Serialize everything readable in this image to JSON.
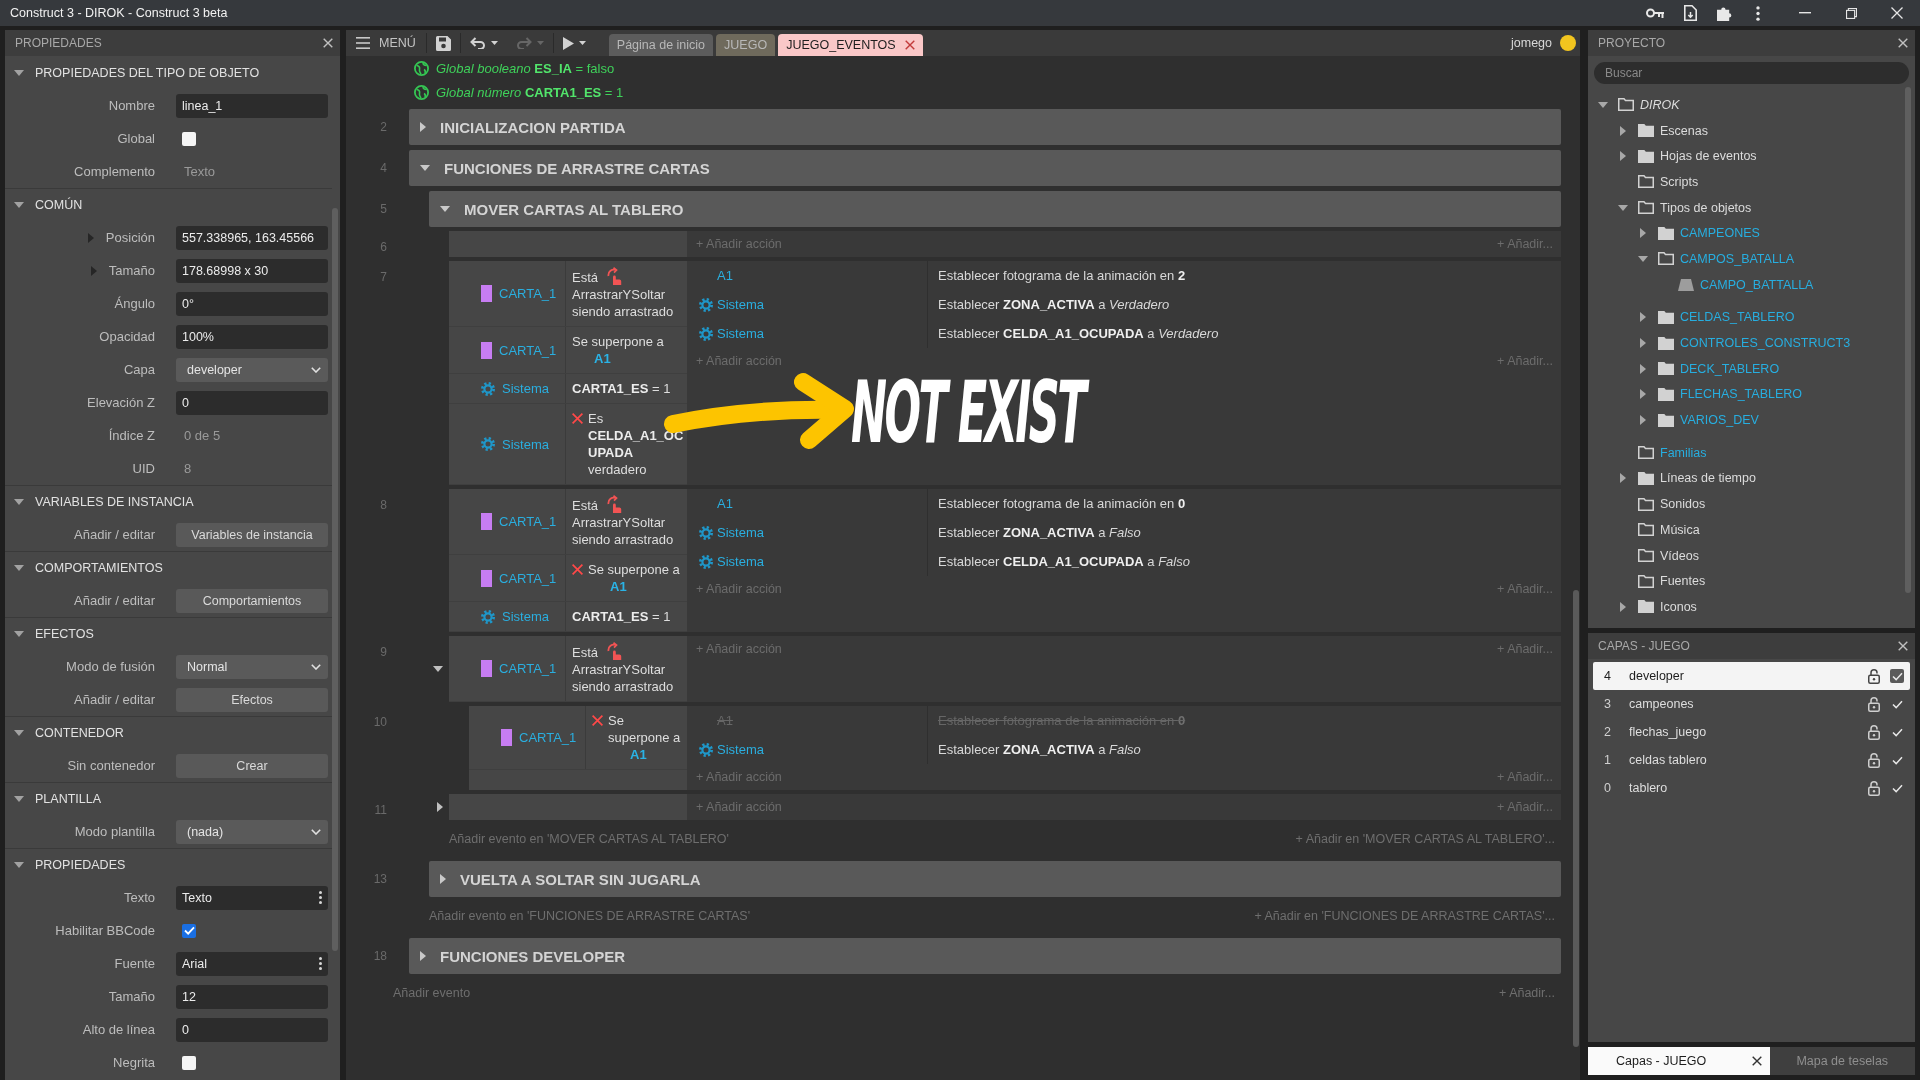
{
  "title_bar": {
    "title": "Construct 3 - DIROK - Construct 3 beta"
  },
  "properties_panel": {
    "title": "PROPIEDADES",
    "sections": [
      {
        "title": "PROPIEDADES DEL TIPO DE OBJETO",
        "expanded": true,
        "rows": [
          {
            "label": "Nombre",
            "kind": "input",
            "value": "linea_1"
          },
          {
            "label": "Global",
            "kind": "checkbox",
            "checked": false
          },
          {
            "label": "Complemento",
            "kind": "readonly",
            "value": "Texto"
          }
        ]
      },
      {
        "title": "COMÚN",
        "expanded": true,
        "rows": [
          {
            "label": "Posición",
            "kind": "input",
            "value": "557.338965, 163.45566",
            "expanded": false
          },
          {
            "label": "Tamaño",
            "kind": "input",
            "value": "178.68998 x 30",
            "expanded": false
          },
          {
            "label": "Ángulo",
            "kind": "input",
            "value": "0°"
          },
          {
            "label": "Opacidad",
            "kind": "input",
            "value": "100%"
          },
          {
            "label": "Capa",
            "kind": "select",
            "value": "developer"
          },
          {
            "label": "Elevación Z",
            "kind": "input",
            "value": "0"
          },
          {
            "label": "Índice Z",
            "kind": "readonly",
            "value": "0 de 5"
          },
          {
            "label": "UID",
            "kind": "readonly",
            "value": "8"
          }
        ]
      },
      {
        "title": "VARIABLES DE INSTANCIA",
        "expanded": true,
        "rows": [
          {
            "label": "Añadir / editar",
            "kind": "button",
            "value": "Variables de instancia"
          }
        ]
      },
      {
        "title": "COMPORTAMIENTOS",
        "expanded": true,
        "rows": [
          {
            "label": "Añadir / editar",
            "kind": "button",
            "value": "Comportamientos"
          }
        ]
      },
      {
        "title": "EFECTOS",
        "expanded": true,
        "rows": [
          {
            "label": "Modo de fusión",
            "kind": "select",
            "value": "Normal"
          },
          {
            "label": "Añadir / editar",
            "kind": "button",
            "value": "Efectos"
          }
        ]
      },
      {
        "title": "CONTENEDOR",
        "expanded": true,
        "rows": [
          {
            "label": "Sin contenedor",
            "kind": "button",
            "value": "Crear"
          }
        ]
      },
      {
        "title": "PLANTILLA",
        "expanded": true,
        "rows": [
          {
            "label": "Modo plantilla",
            "kind": "select",
            "value": "(nada)"
          }
        ]
      },
      {
        "title": "PROPIEDADES",
        "expanded": true,
        "rows": [
          {
            "label": "Texto",
            "kind": "input_menu",
            "value": "Texto"
          },
          {
            "label": "Habilitar BBCode",
            "kind": "checkbox",
            "checked": true
          },
          {
            "label": "Fuente",
            "kind": "input_menu",
            "value": "Arial"
          },
          {
            "label": "Tamaño",
            "kind": "input",
            "value": "12"
          },
          {
            "label": "Alto de línea",
            "kind": "input",
            "value": "0"
          },
          {
            "label": "Negrita",
            "kind": "checkbox",
            "checked": false
          }
        ]
      }
    ]
  },
  "editor": {
    "toolbar": {
      "menu_label": "MENÚ",
      "buttons": [
        {
          "kind": "save",
          "disabled": false
        },
        {
          "kind": "undo",
          "disabled": false
        },
        {
          "kind": "redo",
          "disabled": true
        },
        {
          "kind": "run",
          "disabled": false
        }
      ],
      "tabs": [
        {
          "label": "Página de inicio",
          "selected": false,
          "color": "#5c5c5c"
        },
        {
          "label": "JUEGO",
          "selected": false,
          "color": "#6f6a5c"
        },
        {
          "label": "JUEGO_EVENTOS",
          "selected": true,
          "color": "#fac8c8"
        }
      ],
      "user": "jomego"
    },
    "globals": [
      "*Global booleano* **ES_IA** = falso",
      "*Global número* **CARTA1_ES** = 1"
    ],
    "items": [
      {
        "kind": "group",
        "number": "2",
        "title": "INICIALIZACION PARTIDA",
        "expanded": false
      },
      {
        "kind": "group",
        "number": "4",
        "title": "FUNCIONES DE ARRASTRE CARTAS",
        "expanded": true,
        "children": [
          {
            "kind": "group",
            "number": "5",
            "title": "MOVER CARTAS AL TABLERO",
            "expanded": true,
            "children": [
              {
                "kind": "event",
                "number": "6",
                "add_action": "+ Añadir acción",
                "add_more": "+ Añadir..."
              },
              {
                "kind": "event",
                "number": "7",
                "conditions": [
                  {
                    "object": {
                      "name": "CARTA_1",
                      "kind": "sprite"
                    },
                    "kind": "behavior",
                    "inverted": false,
                    "text": "Está",
                    "text_after": "ArrastrarYSoltar siendo arrastrado"
                  },
                  {
                    "object": {
                      "name": "CARTA_1",
                      "kind": "sprite"
                    },
                    "kind": "param",
                    "inverted": false,
                    "text": "Se superpone a",
                    "param": "A1"
                  },
                  {
                    "object": {
                      "name": "Sistema",
                      "kind": "system"
                    },
                    "kind": "plain",
                    "inverted": false,
                    "text": "**CARTA1_ES** = 1"
                  },
                  {
                    "object": {
                      "name": "Sistema",
                      "kind": "system"
                    },
                    "kind": "plain",
                    "inverted": true,
                    "text": "Es **CELDA_A1_OCUPADA** verdadero"
                  }
                ],
                "actions": [
                  {
                    "object": {
                      "name": "A1",
                      "kind": "object"
                    },
                    "disabled": false,
                    "text": "Establecer fotograma de la animación en **2**"
                  },
                  {
                    "object": {
                      "name": "Sistema",
                      "kind": "system"
                    },
                    "disabled": false,
                    "text": "Establecer **ZONA_ACTIVA** a *Verdadero*"
                  },
                  {
                    "object": {
                      "name": "Sistema",
                      "kind": "system"
                    },
                    "disabled": false,
                    "text": "Establecer **CELDA_A1_OCUPADA** a *Verdadero*"
                  }
                ],
                "add_action": "+ Añadir acción",
                "add_more": "+ Añadir..."
              },
              {
                "kind": "event",
                "number": "8",
                "conditions": [
                  {
                    "object": {
                      "name": "CARTA_1",
                      "kind": "sprite"
                    },
                    "kind": "behavior",
                    "inverted": false,
                    "text": "Está",
                    "text_after": "ArrastrarYSoltar siendo arrastrado"
                  },
                  {
                    "object": {
                      "name": "CARTA_1",
                      "kind": "sprite"
                    },
                    "kind": "param",
                    "inverted": true,
                    "text": "Se superpone a",
                    "param": "A1"
                  },
                  {
                    "object": {
                      "name": "Sistema",
                      "kind": "system"
                    },
                    "kind": "plain",
                    "inverted": false,
                    "text": "**CARTA1_ES** = 1"
                  }
                ],
                "actions": [
                  {
                    "object": {
                      "name": "A1",
                      "kind": "object"
                    },
                    "disabled": false,
                    "text": "Establecer fotograma de la animación en **0**"
                  },
                  {
                    "object": {
                      "name": "Sistema",
                      "kind": "system"
                    },
                    "disabled": false,
                    "text": "Establecer **ZONA_ACTIVA** a *Falso*"
                  },
                  {
                    "object": {
                      "name": "Sistema",
                      "kind": "system"
                    },
                    "disabled": false,
                    "text": "Establecer **CELDA_A1_OCUPADA** a *Falso*"
                  }
                ],
                "add_action": "+ Añadir acción",
                "add_more": "+ Añadir..."
              },
              {
                "kind": "event",
                "number": "9",
                "expanded": true,
                "conditions": [
                  {
                    "object": {
                      "name": "CARTA_1",
                      "kind": "sprite"
                    },
                    "kind": "behavior",
                    "inverted": false,
                    "text": "Está",
                    "text_after": "ArrastrarYSoltar siendo arrastrado"
                  }
                ],
                "add_action": "+ Añadir acción",
                "add_more": "+ Añadir...",
                "children": [
                  {
                    "kind": "event",
                    "number": "10",
                    "conditions": [
                      {
                        "object": {
                          "name": "CARTA_1",
                          "kind": "sprite"
                        },
                        "kind": "param",
                        "inverted": true,
                        "text": "Se superpone a",
                        "param": "A1"
                      }
                    ],
                    "actions": [
                      {
                        "object": {
                          "name": "A1",
                          "kind": "object"
                        },
                        "disabled": true,
                        "text": "Establecer fotograma de la animación en **0**"
                      },
                      {
                        "object": {
                          "name": "Sistema",
                          "kind": "system"
                        },
                        "disabled": false,
                        "text": "Establecer **ZONA_ACTIVA** a *Falso*"
                      }
                    ],
                    "add_action": "+ Añadir acción",
                    "add_more": "+ Añadir..."
                  }
                ]
              },
              {
                "kind": "event",
                "number": "11",
                "expanded": false,
                "add_action": "+ Añadir acción",
                "add_more": "+ Añadir..."
              },
              {
                "kind": "add_event",
                "text": "Añadir evento en 'MOVER CARTAS AL TABLERO'",
                "add_more": "+ Añadir en 'MOVER CARTAS AL TABLERO'..."
              }
            ]
          },
          {
            "kind": "group",
            "number": "13",
            "title": "VUELTA A SOLTAR SIN JUGARLA",
            "expanded": false
          },
          {
            "kind": "add_event",
            "text": "Añadir evento en 'FUNCIONES DE ARRASTRE CARTAS'",
            "add_more": "+ Añadir en 'FUNCIONES DE ARRASTRE CARTAS'..."
          }
        ]
      },
      {
        "kind": "group",
        "number": "18",
        "title": "FUNCIONES DEVELOPER",
        "expanded": false
      },
      {
        "kind": "add_event",
        "text": "Añadir evento",
        "add_more": "+ Añadir..."
      }
    ]
  },
  "annotation": {
    "text": "NOT EXIST"
  },
  "project_panel": {
    "title": "PROYECTO",
    "search": {
      "placeholder": "Buscar"
    },
    "tree": [
      {
        "label": "DIROK",
        "kind": "root",
        "expanded": true,
        "children": [
          {
            "label": "Escenas",
            "kind": "folder",
            "expanded": false
          },
          {
            "label": "Hojas de eventos",
            "kind": "folder",
            "expanded": false
          },
          {
            "label": "Scripts",
            "kind": "folder"
          },
          {
            "label": "Tipos de objetos",
            "kind": "folder",
            "expanded": true,
            "children": [
              {
                "label": "CAMPEONES",
                "kind": "type_folder",
                "expanded": false
              },
              {
                "label": "CAMPOS_BATALLA",
                "kind": "type_folder",
                "expanded": true,
                "children": [
                  {
                    "label": "CAMPO_BATTALLA",
                    "kind": "object"
                  }
                ]
              },
              {
                "label": "CELDAS_TABLERO",
                "kind": "type_folder",
                "expanded": false
              },
              {
                "label": "CONTROLES_CONSTRUCT3",
                "kind": "type_folder",
                "expanded": false
              },
              {
                "label": "DECK_TABLERO",
                "kind": "type_folder",
                "expanded": false
              },
              {
                "label": "FLECHAS_TABLERO",
                "kind": "type_folder",
                "expanded": false
              },
              {
                "label": "VARIOS_DEV",
                "kind": "type_folder",
                "expanded": false
              }
            ]
          },
          {
            "label": "Familias",
            "kind": "type_folder"
          },
          {
            "label": "Líneas de tiempo",
            "kind": "folder",
            "expanded": false
          },
          {
            "label": "Sonidos",
            "kind": "folder"
          },
          {
            "label": "Música",
            "kind": "folder"
          },
          {
            "label": "Vídeos",
            "kind": "folder"
          },
          {
            "label": "Fuentes",
            "kind": "folder"
          },
          {
            "label": "Iconos",
            "kind": "folder",
            "expanded": false
          }
        ]
      }
    ]
  },
  "layers_panel": {
    "title": "CAPAS - JUEGO",
    "layers": [
      {
        "index": "4",
        "name": "developer",
        "selected": true,
        "locked": false,
        "visible": true
      },
      {
        "index": "3",
        "name": "campeones",
        "selected": false,
        "locked": false,
        "visible": true
      },
      {
        "index": "2",
        "name": "flechas_juego",
        "selected": false,
        "locked": false,
        "visible": true
      },
      {
        "index": "1",
        "name": "celdas tablero",
        "selected": false,
        "locked": false,
        "visible": true
      },
      {
        "index": "0",
        "name": "tablero",
        "selected": false,
        "locked": false,
        "visible": true
      }
    ],
    "tabs": [
      {
        "label": "Capas - JUEGO",
        "selected": true
      },
      {
        "label": "Mapa de teselas",
        "selected": false
      }
    ]
  }
}
